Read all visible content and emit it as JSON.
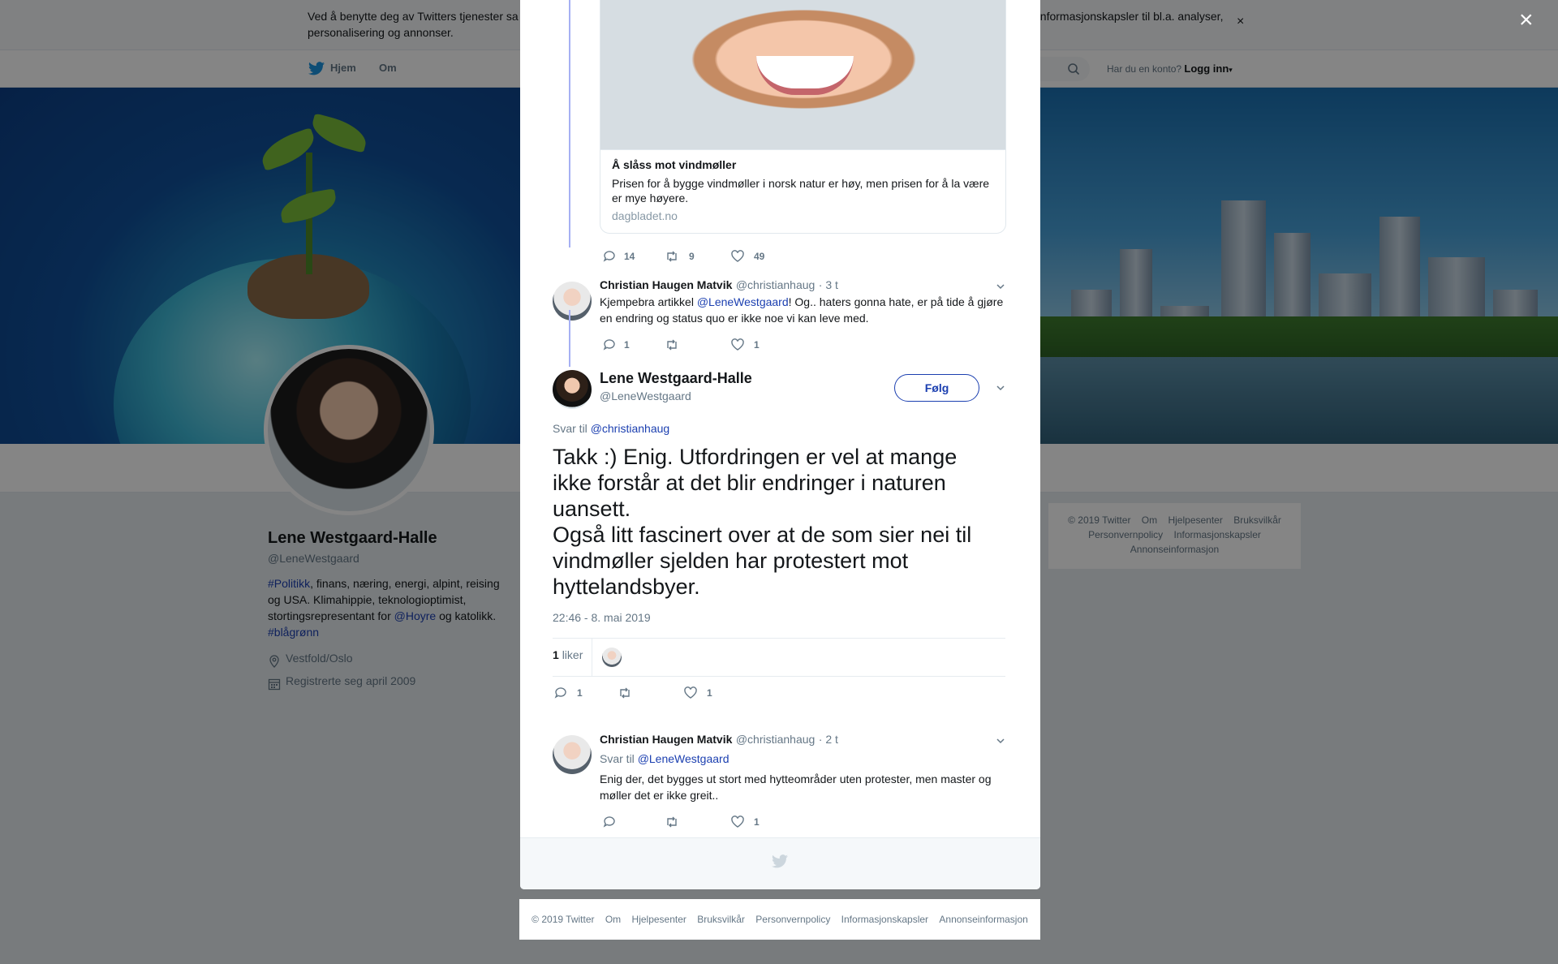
{
  "cookie_banner": {
    "text": "Ved å benytte deg av Twitters tjenester samtykker du i at vi og våre partnere bruker informasjonskapsler til bl.a. analyser, personalisering og annonser.",
    "text_left": "Ved å benytte deg av Twitters tjenester sa",
    "text_right": "informasjonskapsler til bl.a. analyser,",
    "text_line2": "personalisering og annonser.",
    "close": "×"
  },
  "topnav": {
    "home": "Hjem",
    "about": "Om",
    "has_account": "Har du en konto?",
    "login": "Logg inn"
  },
  "profile": {
    "name": "Lene Westgaard-Halle",
    "handle": "@LeneWestgaard",
    "bio_hashtag1": "#Politikk",
    "bio_part1": ", finans, næring, energi, alpint, reising og USA. Klimahippie, teknologioptimist, stortingsrepresentant for ",
    "bio_mention": "@Hoyre",
    "bio_part2": " og katolikk. ",
    "bio_hashtag2": "#blågrønn",
    "location": "Vestfold/Oslo",
    "joined": "Registrerte seg april 2009"
  },
  "side_footer": {
    "links": [
      "© 2019 Twitter",
      "Om",
      "Hjelpesenter",
      "Bruksvilkår",
      "Personvernpolicy",
      "Informasjonskapsler",
      "Annonseinformasjon"
    ]
  },
  "modal": {
    "close": "×",
    "card": {
      "title": "Å slåss mot vindmøller",
      "description": "Prisen for å bygge vindmøller i norsk natur er høy, men prisen for å la være er mye høyere.",
      "domain": "dagbladet.no"
    },
    "parent_actions": {
      "replies": "14",
      "retweets": "9",
      "likes": "49"
    },
    "reply1": {
      "author": "Christian Haugen Matvik",
      "handle": "@christianhaug",
      "time": "· 3 t",
      "text_before": "Kjempebra artikkel ",
      "mention": "@LeneWestgaard",
      "text_after": "! Og.. haters gonna hate, er på tide å gjøre en endring og status quo er ikke noe vi kan leve med.",
      "replies": "1",
      "likes": "1"
    },
    "main_tweet": {
      "author": "Lene Westgaard-Halle",
      "handle": "@LeneWestgaard",
      "follow": "Følg",
      "reply_to_label": "Svar til",
      "reply_to": "@christianhaug",
      "text_line1": "Takk :) Enig. Utfordringen er vel at mange ikke forstår at det blir endringer i naturen uansett.",
      "text_line2": "Også litt fascinert over at de som sier nei til vindmøller sjelden har protestert mot hyttelandsbyer.",
      "timestamp": "22:46 - 8. mai 2019",
      "likes_count": "1",
      "likes_label": "liker",
      "replies": "1",
      "likes": "1"
    },
    "reply2": {
      "author": "Christian Haugen Matvik",
      "handle": "@christianhaug",
      "time": "· 2 t",
      "reply_to_label": "Svar til",
      "reply_to": "@LeneWestgaard",
      "text": "Enig der, det bygges ut stort med hytteområder uten protester, men master og møller det er ikke greit..",
      "likes": "1"
    }
  },
  "bottom_footer": {
    "links": [
      "© 2019 Twitter",
      "Om",
      "Hjelpesenter",
      "Bruksvilkår",
      "Personvernpolicy",
      "Informasjonskapsler",
      "Annonseinformasjon"
    ]
  },
  "colors": {
    "link": "#1b3fb0",
    "thread_line": "#a6b0f3",
    "muted": "#657786"
  }
}
